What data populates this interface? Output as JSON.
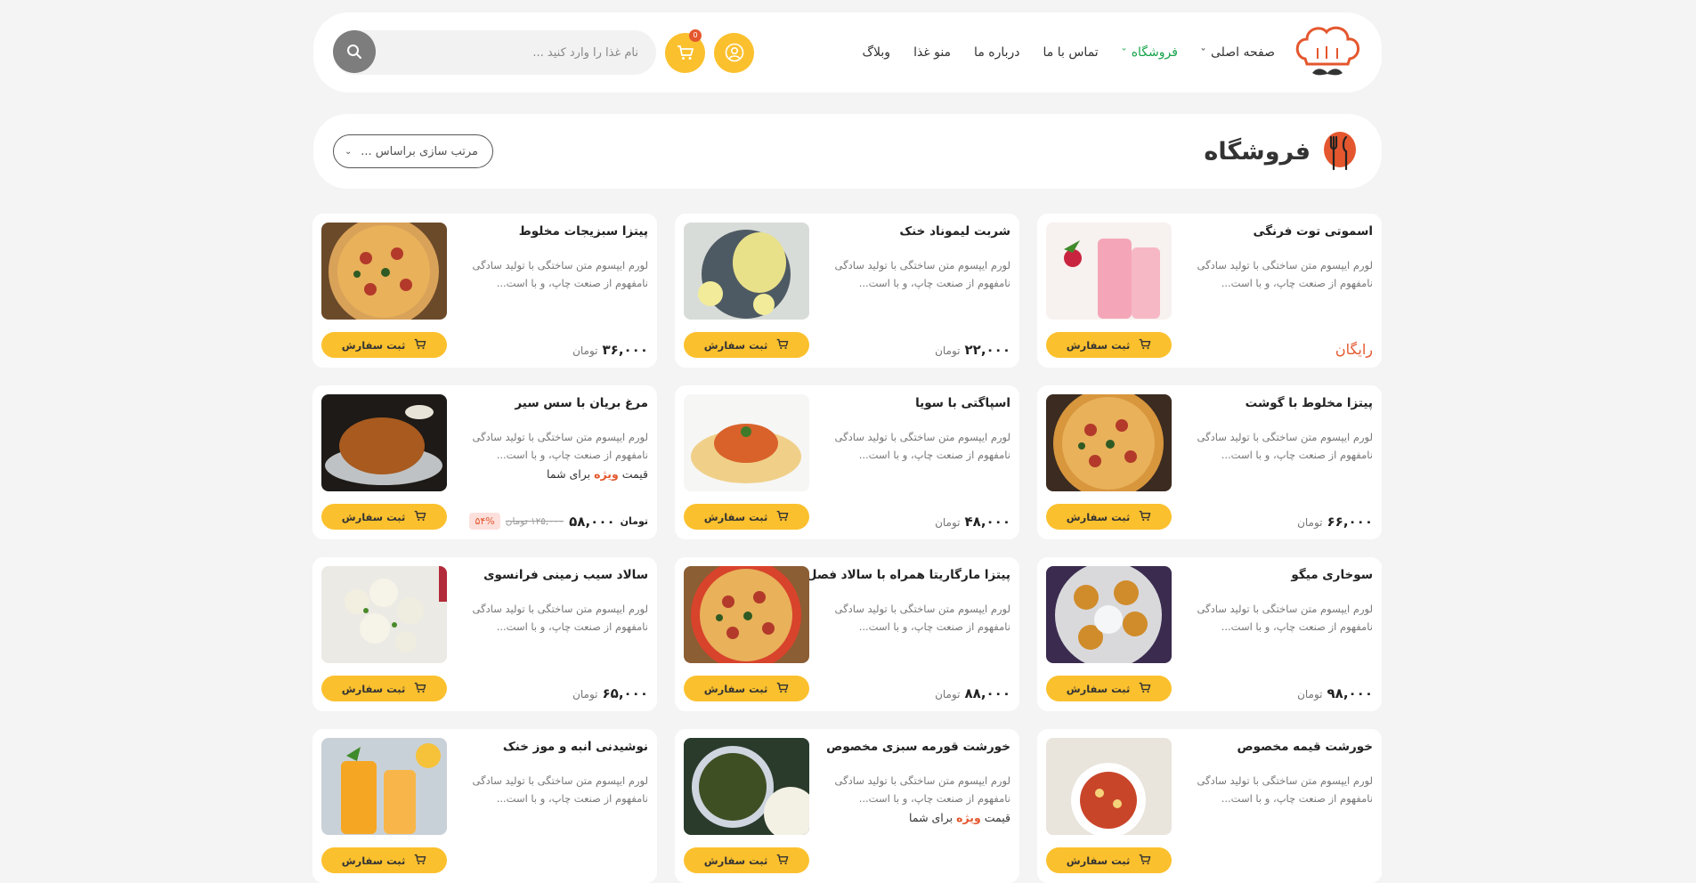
{
  "nav": {
    "items": [
      {
        "label": "صفحه اصلی",
        "dropdown": true,
        "active": false
      },
      {
        "label": "فروشگاه",
        "dropdown": true,
        "active": true
      },
      {
        "label": "تماس با ما",
        "dropdown": false,
        "active": false
      },
      {
        "label": "درباره ما",
        "dropdown": false,
        "active": false
      },
      {
        "label": "منو غذا",
        "dropdown": false,
        "active": false
      },
      {
        "label": "وبلاگ",
        "dropdown": false,
        "active": false
      }
    ]
  },
  "search": {
    "placeholder": "نام غذا را وارد کنید ..."
  },
  "cart": {
    "count": "0"
  },
  "page": {
    "title": "فروشگاه",
    "sort_label": "مرتب سازی براساس ..."
  },
  "colors": {
    "accent": "#fbc02d",
    "active_nav": "#16a34a",
    "danger": "#e4572e"
  },
  "products": [
    {
      "title": "اسموتی توت فرنگی",
      "desc": "لورم ایپسوم متن ساختگی با تولید سادگی نامفهوم از صنعت چاپ، و با است...",
      "price": "",
      "unit": "",
      "free_label": "رایگان",
      "image": "strawberry-smoothie",
      "button": "ثبت سفارش"
    },
    {
      "title": "شربت لیموناد خنک",
      "desc": "لورم ایپسوم متن ساختگی با تولید سادگی نامفهوم از صنعت چاپ، و با است...",
      "price": "۲۲,۰۰۰",
      "unit": "تومان",
      "image": "lemonade",
      "button": "ثبت سفارش"
    },
    {
      "title": "پیتزا سبزیجات مخلوط",
      "desc": "لورم ایپسوم متن ساختگی با تولید سادگی نامفهوم از صنعت چاپ، و با است...",
      "price": "۳۶,۰۰۰",
      "unit": "تومان",
      "image": "veggie-pizza",
      "button": "ثبت سفارش"
    },
    {
      "title": "پیتزا مخلوط با گوشت",
      "desc": "لورم ایپسوم متن ساختگی با تولید سادگی نامفهوم از صنعت چاپ، و با است...",
      "price": "۶۶,۰۰۰",
      "unit": "تومان",
      "image": "meat-pizza",
      "button": "ثبت سفارش"
    },
    {
      "title": "اسپاگتی با سویا",
      "desc": "لورم ایپسوم متن ساختگی با تولید سادگی نامفهوم از صنعت چاپ، و با است...",
      "price": "۴۸,۰۰۰",
      "unit": "تومان",
      "image": "spaghetti",
      "button": "ثبت سفارش"
    },
    {
      "title": "مرغ بریان با سس سیر",
      "desc": "لورم ایپسوم متن ساختگی با تولید سادگی نامفهوم از صنعت چاپ، و با است...",
      "special_pre": "قیمت",
      "special_hl": "ویژه",
      "special_post": "برای شما",
      "discount": "۵۴%",
      "old_price": "۱۲۵,۰۰۰ تومان",
      "new_price": "۵۸,۰۰۰",
      "new_unit": "تومان",
      "image": "roast-chicken",
      "button": "ثبت سفارش"
    },
    {
      "title": "سوخاری میگو",
      "desc": "لورم ایپسوم متن ساختگی با تولید سادگی نامفهوم از صنعت چاپ، و با است...",
      "price": "۹۸,۰۰۰",
      "unit": "تومان",
      "image": "fried-shrimp",
      "button": "ثبت سفارش"
    },
    {
      "title": "پیتزا مارگاریتا همراه با سالاد فصل",
      "desc": "لورم ایپسوم متن ساختگی با تولید سادگی نامفهوم از صنعت چاپ، و با است...",
      "price": "۸۸,۰۰۰",
      "unit": "تومان",
      "image": "margherita-pizza",
      "button": "ثبت سفارش"
    },
    {
      "title": "سالاد سیب زمینی فرانسوی",
      "desc": "لورم ایپسوم متن ساختگی با تولید سادگی نامفهوم از صنعت چاپ، و با است...",
      "price": "۶۵,۰۰۰",
      "unit": "تومان",
      "image": "potato-salad",
      "button": "ثبت سفارش"
    },
    {
      "title": "خورشت قیمه مخصوص",
      "desc": "لورم ایپسوم متن ساختگی با تولید سادگی نامفهوم از صنعت چاپ، و با است...",
      "price": "",
      "unit": "",
      "image": "gheimeh-stew",
      "button": "ثبت سفارش"
    },
    {
      "title": "خورشت قورمه سبزی مخصوص",
      "desc": "لورم ایپسوم متن ساختگی با تولید سادگی نامفهوم از صنعت چاپ، و با است...",
      "special_pre": "قیمت",
      "special_hl": "ویژه",
      "special_post": "برای شما",
      "image": "ghormeh-sabzi",
      "button": "ثبت سفارش"
    },
    {
      "title": "نوشیدنی انبه و موز خنک",
      "desc": "لورم ایپسوم متن ساختگی با تولید سادگی نامفهوم از صنعت چاپ، و با است...",
      "price": "",
      "unit": "",
      "image": "mango-banana-drink",
      "button": "ثبت سفارش"
    }
  ]
}
